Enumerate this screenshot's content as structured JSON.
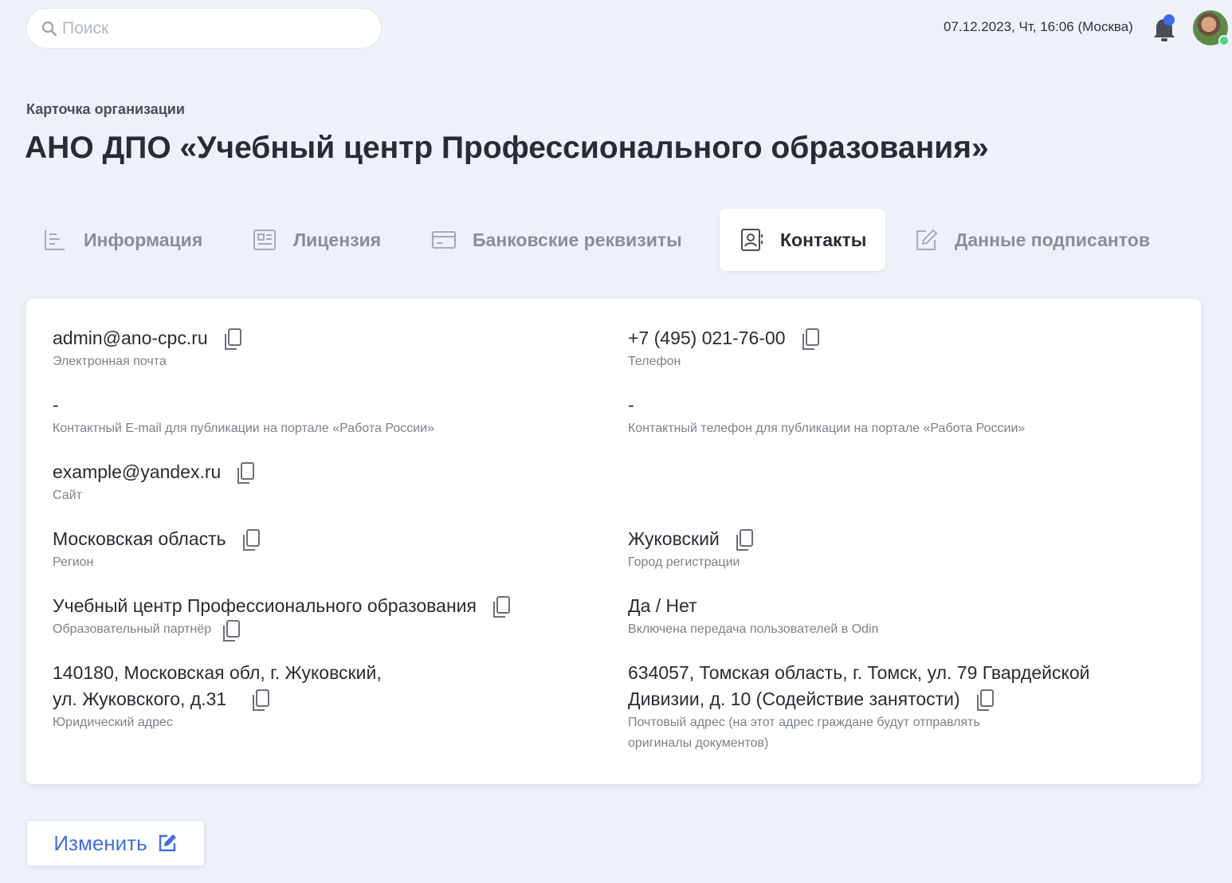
{
  "search": {
    "placeholder": "Поиск"
  },
  "header": {
    "datetime": "07.12.2023, Чт, 16:06 (Москва)"
  },
  "page": {
    "breadcrumb": "Карточка организации",
    "title": "АНО ДПО «Учебный центр Профессионального образования»"
  },
  "tabs": [
    {
      "label": "Информация",
      "icon": "list-icon"
    },
    {
      "label": "Лицензия",
      "icon": "document-icon"
    },
    {
      "label": "Банковские реквизиты",
      "icon": "card-icon"
    },
    {
      "label": "Контакты",
      "icon": "contact-icon",
      "active": true
    },
    {
      "label": "Данные подписантов",
      "icon": "edit-icon"
    }
  ],
  "contacts": {
    "email": {
      "value": "admin@ano-cpc.ru",
      "label": "Электронная почта"
    },
    "phone": {
      "value": "+7 (495) 021-76-00",
      "label": "Телефон"
    },
    "pub_email": {
      "value": "-",
      "label": "Контактный E-mail для публикации на портале «Работа России»"
    },
    "pub_phone": {
      "value": "-",
      "label": "Контактный телефон для публикации на портале «Работа России»"
    },
    "site": {
      "value": "example@yandex.ru",
      "label": "Сайт"
    },
    "region": {
      "value": "Московская область",
      "label": "Регион"
    },
    "city": {
      "value": "Жуковский",
      "label": "Город регистрации"
    },
    "partner": {
      "value": "Учебный центр Профессионального образования",
      "label": "Образовательный партнёр"
    },
    "odin": {
      "value": "Да / Нет",
      "label": "Включена передача пользователей в Odin"
    },
    "legal_address": {
      "line1": "140180, Московская обл, г. Жуковский,",
      "line2": "ул. Жуковского, д.31",
      "label": "Юридический адрес"
    },
    "postal_address": {
      "line1": "634057, Томская область, г. Томск, ул. 79 Гвардейской",
      "line2": "Дивизии, д. 10 (Содействие занятости)",
      "label_line1": "Почтовый адрес (на этот адрес граждане будут отправлять",
      "label_line2": "оригиналы документов)"
    }
  },
  "actions": {
    "edit_label": "Изменить"
  },
  "colors": {
    "accent": "#3f6fe0",
    "background": "#eef1f9",
    "online": "#4cd67a"
  }
}
